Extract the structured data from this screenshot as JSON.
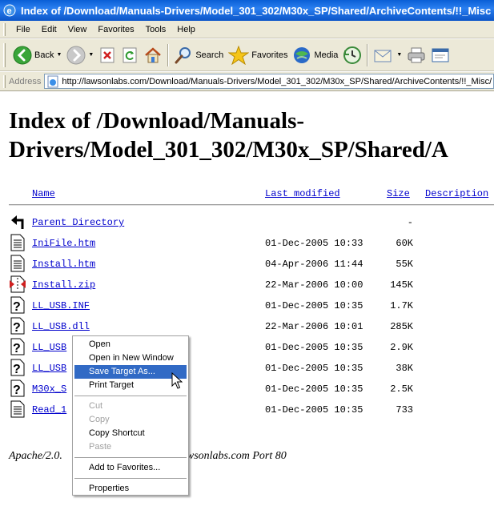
{
  "window": {
    "title": "Index of /Download/Manuals-Drivers/Model_301_302/M30x_SP/Shared/ArchiveContents/!!_Misc"
  },
  "menubar": {
    "items": [
      "File",
      "Edit",
      "View",
      "Favorites",
      "Tools",
      "Help"
    ]
  },
  "toolbar": {
    "back_label": "Back",
    "search_label": "Search",
    "favorites_label": "Favorites",
    "media_label": "Media"
  },
  "addressbar": {
    "label": "Address",
    "url": "http://lawsonlabs.com/Download/Manuals-Drivers/Model_301_302/M30x_SP/Shared/ArchiveContents/!!_Misc/"
  },
  "page": {
    "heading_line1": "Index of /Download/Manuals-",
    "heading_line2": "Drivers/Model_301_302/M30x_SP/Shared/A",
    "columns": {
      "name": "Name",
      "last_modified": "Last modified",
      "size": "Size",
      "description": "Description"
    },
    "rows": [
      {
        "icon": "parent-directory-icon",
        "name": "Parent Directory",
        "date": "",
        "size": "-"
      },
      {
        "icon": "text-document-icon",
        "name": "IniFile.htm",
        "date": "01-Dec-2005 10:33",
        "size": "60K"
      },
      {
        "icon": "text-document-icon",
        "name": "Install.htm",
        "date": "04-Apr-2006 11:44",
        "size": "55K"
      },
      {
        "icon": "compressed-file-icon",
        "name": "Install.zip",
        "date": "22-Mar-2006 10:00",
        "size": "145K"
      },
      {
        "icon": "unknown-file-icon",
        "name": "LL_USB.INF",
        "date": "01-Dec-2005 10:35",
        "size": "1.7K"
      },
      {
        "icon": "unknown-file-icon",
        "name": "LL_USB.dll",
        "date": "22-Mar-2006 10:01",
        "size": "285K"
      },
      {
        "icon": "unknown-file-icon",
        "name": "LL_USB",
        "date": "01-Dec-2005 10:35",
        "size": "2.9K"
      },
      {
        "icon": "unknown-file-icon",
        "name": "LL_USB",
        "date": "01-Dec-2005 10:35",
        "size": "38K"
      },
      {
        "icon": "unknown-file-icon",
        "name": "M30x_S",
        "date": "01-Dec-2005 10:35",
        "size": "2.5K"
      },
      {
        "icon": "text-document-icon",
        "name": "Read_1",
        "date": "01-Dec-2005 10:35",
        "size": "733"
      }
    ],
    "footer_left": "Apache/2.0.",
    "footer_right": "awsonlabs.com Port 80"
  },
  "context_menu": {
    "open": "Open",
    "open_new_window": "Open in New Window",
    "save_target_as": "Save Target As...",
    "print_target": "Print Target",
    "cut": "Cut",
    "copy": "Copy",
    "copy_shortcut": "Copy Shortcut",
    "paste": "Paste",
    "add_to_favorites": "Add to Favorites...",
    "properties": "Properties"
  },
  "colors": {
    "titlebar": "#0a5fd6",
    "link": "#0000cc",
    "menu_highlight": "#316ac5",
    "chrome": "#ece9d8"
  }
}
